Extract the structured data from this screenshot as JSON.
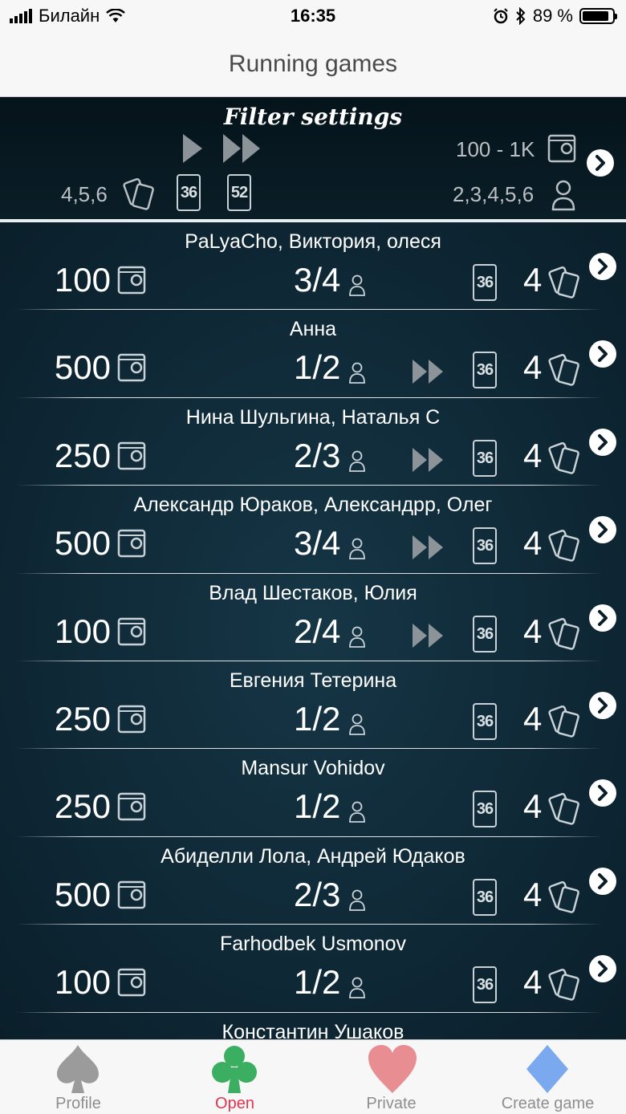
{
  "status": {
    "carrier": "Билайн",
    "time": "16:35",
    "battery": "89 %",
    "battery_level": 0.89
  },
  "nav": {
    "title": "Running games"
  },
  "filter": {
    "title": "Filter settings",
    "bet_range": "100 - 1K",
    "suits": "4,5,6",
    "decks": [
      "36",
      "52"
    ],
    "players": "2,3,4,5,6"
  },
  "games": [
    {
      "names": "PaLyaCho, Виктория, олеся",
      "bet": "100",
      "players": "3/4",
      "fast": false,
      "deck": "36",
      "suits": "4"
    },
    {
      "names": "Анна",
      "bet": "500",
      "players": "1/2",
      "fast": true,
      "deck": "36",
      "suits": "4"
    },
    {
      "names": "Нина Шульгина, Наталья С",
      "bet": "250",
      "players": "2/3",
      "fast": true,
      "deck": "36",
      "suits": "4"
    },
    {
      "names": "Александр Юраков, Александрр, Олег",
      "bet": "500",
      "players": "3/4",
      "fast": true,
      "deck": "36",
      "suits": "4"
    },
    {
      "names": "Влад Шестаков, Юлия",
      "bet": "100",
      "players": "2/4",
      "fast": true,
      "deck": "36",
      "suits": "4"
    },
    {
      "names": "Евгения Тетерина",
      "bet": "250",
      "players": "1/2",
      "fast": false,
      "deck": "36",
      "suits": "4"
    },
    {
      "names": "Mansur Vohidov",
      "bet": "250",
      "players": "1/2",
      "fast": false,
      "deck": "36",
      "suits": "4"
    },
    {
      "names": "Абиделли Лола, Андрей Юдаков",
      "bet": "500",
      "players": "2/3",
      "fast": false,
      "deck": "36",
      "suits": "4"
    },
    {
      "names": "Farhodbek Usmonov",
      "bet": "100",
      "players": "1/2",
      "fast": false,
      "deck": "36",
      "suits": "4"
    },
    {
      "names": "Константин Ушаков",
      "bet": "",
      "players": "",
      "fast": false,
      "deck": "",
      "suits": ""
    }
  ],
  "tabs": [
    {
      "label": "Profile",
      "icon": "spade-icon",
      "color": "#9b9b9b"
    },
    {
      "label": "Open",
      "icon": "club-icon",
      "color": "#3cae61",
      "active": true
    },
    {
      "label": "Private",
      "icon": "heart-icon",
      "color": "#e88d92"
    },
    {
      "label": "Create game",
      "icon": "diamond-icon",
      "color": "#7aa9ef"
    }
  ]
}
